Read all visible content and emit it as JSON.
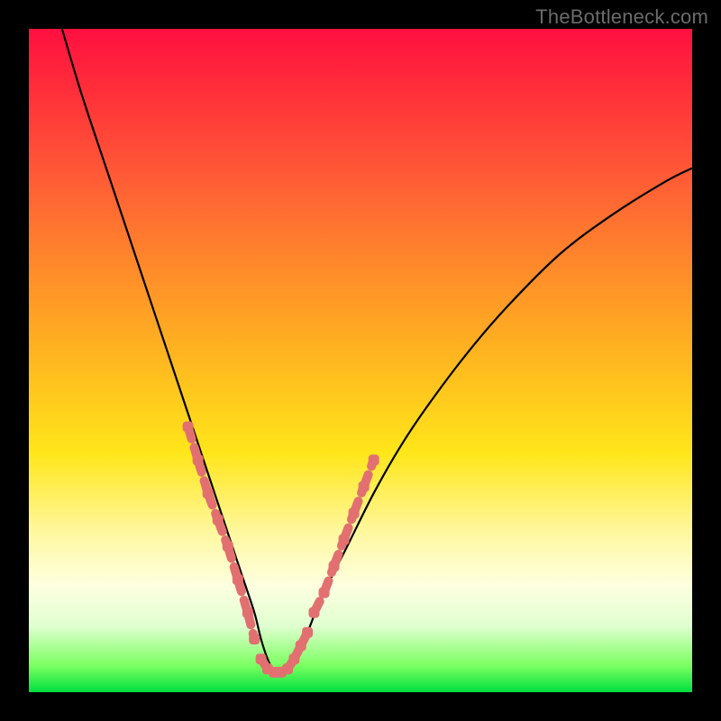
{
  "watermark": "TheBottleneck.com",
  "chart_data": {
    "type": "line",
    "title": "",
    "xlabel": "",
    "ylabel": "",
    "xlim": [
      0,
      100
    ],
    "ylim": [
      0,
      100
    ],
    "grid": false,
    "legend": false,
    "annotations": [],
    "series": [
      {
        "name": "bottleneck-curve",
        "stroke": "#000000",
        "x": [
          5,
          8,
          12,
          16,
          20,
          24,
          26,
          28,
          30,
          32,
          34,
          35,
          36,
          37,
          38,
          40,
          42,
          44,
          48,
          52,
          56,
          60,
          66,
          72,
          80,
          88,
          96,
          100
        ],
        "y": [
          100,
          90,
          78,
          66,
          54,
          42,
          36,
          30,
          24,
          18,
          12,
          8,
          5,
          3,
          3,
          5,
          9,
          14,
          22,
          30,
          37,
          43,
          51,
          58,
          66,
          72,
          77,
          79
        ]
      },
      {
        "name": "highlight-dots-left",
        "stroke": "#e27070",
        "marker": "dash-dot",
        "x": [
          24,
          25.5,
          27,
          28.5,
          30,
          31.5,
          33,
          34
        ],
        "y": [
          40,
          35,
          30,
          26,
          22,
          17,
          12,
          8
        ]
      },
      {
        "name": "highlight-dots-bottom",
        "stroke": "#e27070",
        "marker": "dash-dot",
        "x": [
          35,
          36,
          37,
          38,
          39,
          40,
          41,
          42
        ],
        "y": [
          5,
          3.5,
          3,
          3,
          3.5,
          5,
          7,
          9
        ]
      },
      {
        "name": "highlight-dots-right",
        "stroke": "#e27070",
        "marker": "dash-dot",
        "x": [
          43,
          44.5,
          46,
          47.5,
          49,
          50.5,
          52
        ],
        "y": [
          12,
          15,
          19,
          23,
          27,
          31,
          35
        ]
      }
    ],
    "background_gradient": {
      "type": "vertical",
      "stops": [
        {
          "pos": 0.0,
          "color": "#ff1040"
        },
        {
          "pos": 0.5,
          "color": "#ffe61a"
        },
        {
          "pos": 0.84,
          "color": "#fdffe0"
        },
        {
          "pos": 1.0,
          "color": "#00e040"
        }
      ]
    }
  }
}
